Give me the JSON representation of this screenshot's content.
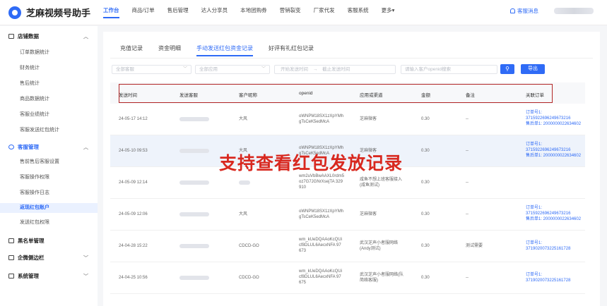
{
  "app": {
    "name": "芝麻视频号助手"
  },
  "topnav": [
    {
      "label": "工作台",
      "active": true
    },
    {
      "label": "商品/订单"
    },
    {
      "label": "售后管理"
    },
    {
      "label": "达人分享员"
    },
    {
      "label": "本地团购券"
    },
    {
      "label": "营销裂变"
    },
    {
      "label": "厂家代发"
    },
    {
      "label": "客服系统"
    },
    {
      "label": "更多▾"
    }
  ],
  "header": {
    "messages_label": "客服消息"
  },
  "sidebar": {
    "groups": [
      {
        "label": "店铺数据",
        "items": [
          "订单数据统计",
          "财务统计",
          "售后统计",
          "商品数据统计",
          "客服业绩统计",
          "客服发送红包统计"
        ]
      },
      {
        "label": "客服管理",
        "items": [
          "售前售后客服设置",
          "客服操作权限",
          "客服操作日志",
          "返现红包账户",
          "发送红包权限"
        ]
      },
      {
        "label": "黑名单管理",
        "items": []
      },
      {
        "label": "企微侧边栏",
        "items": []
      },
      {
        "label": "系统管理",
        "items": []
      }
    ],
    "active_item": "返现红包账户"
  },
  "tabs": [
    {
      "label": "充值记录"
    },
    {
      "label": "资金明细"
    },
    {
      "label": "手动发送红包资金记录",
      "active": true
    },
    {
      "label": "好评有礼红包记录"
    }
  ],
  "filters": {
    "agent_placeholder": "全部客服",
    "app_placeholder": "全部应用",
    "start_placeholder": "开始发送时间",
    "range_sep": "→",
    "end_placeholder": "截止发送时间",
    "openid_placeholder": "请输入客户openid搜索",
    "export_label": "导出"
  },
  "table": {
    "columns": [
      "发送时间",
      "发送客服",
      "客户昵称",
      "openid",
      "应用或渠道",
      "金额",
      "备注",
      "关联订单"
    ],
    "rows": [
      {
        "time": "24-05-17 14:12",
        "nickname": "大风",
        "openid": [
          "oWNPM18SX1zXpYMh",
          "gTsCeK5edMcA"
        ],
        "channel": [
          "芝麻微客"
        ],
        "amount": "0.30",
        "note": "--",
        "orders": [
          "订单号1:",
          "3715922696249673216",
          "售后单1: 2000000022634602"
        ]
      },
      {
        "time": "24-05-10 09:53",
        "nickname": "大风",
        "openid": [
          "oWNPM18SX1zXpYMh",
          "gTsCeK5edMcA"
        ],
        "channel": [
          "芝麻微客"
        ],
        "amount": "0.30",
        "note": "--",
        "orders": [
          "订单号1:",
          "3715922696249673216",
          "售后单1: 2000000022634602"
        ],
        "highlight": true
      },
      {
        "time": "24-05-09 12:14",
        "nickname": "",
        "openid": [
          "wm2uVbBwAAXL0rdm5",
          "oz7G7JGNrXsejTA 329",
          "910"
        ],
        "channel": [
          "咸鱼不想上班客服接入",
          "(咸鱼测试)"
        ],
        "amount": "0.30",
        "note": "--",
        "orders": []
      },
      {
        "time": "24-05-09 12:06",
        "nickname": "大风",
        "openid": [
          "oWNPM18SX1zXpYMh",
          "gTsCeK5edMcA"
        ],
        "channel": [
          "芝麻微客"
        ],
        "amount": "0.30",
        "note": "--",
        "orders": [
          "订单号1:",
          "3715922696249673216",
          "售后单1: 2000000022634602"
        ]
      },
      {
        "time": "24-04-28 15:22",
        "nickname": "CDCD-GO",
        "openid": [
          "wm_kUeDQAAoKcQUi",
          "cf8DLUL6AecxNFA 97",
          "673"
        ],
        "channel": [
          "武汉芝声小者服网络",
          "(Andy测试)"
        ],
        "amount": "0.30",
        "note": "测试需要",
        "orders": [
          "订单号1:",
          "3719020073225161728"
        ]
      },
      {
        "time": "24-04-25 10:56",
        "nickname": "CDCD-GO",
        "openid": [
          "wm_kUeDQAAoKcQUi",
          "cf8DLUL6AecxNFA 97",
          "675"
        ],
        "channel": [
          "武汉芝声小者服网络(队",
          "简络客服)"
        ],
        "amount": "0.30",
        "note": "--",
        "orders": [
          "订单号1:",
          "3719020073225161728"
        ]
      }
    ]
  },
  "overlay_caption": "支持查看红包发放记录"
}
